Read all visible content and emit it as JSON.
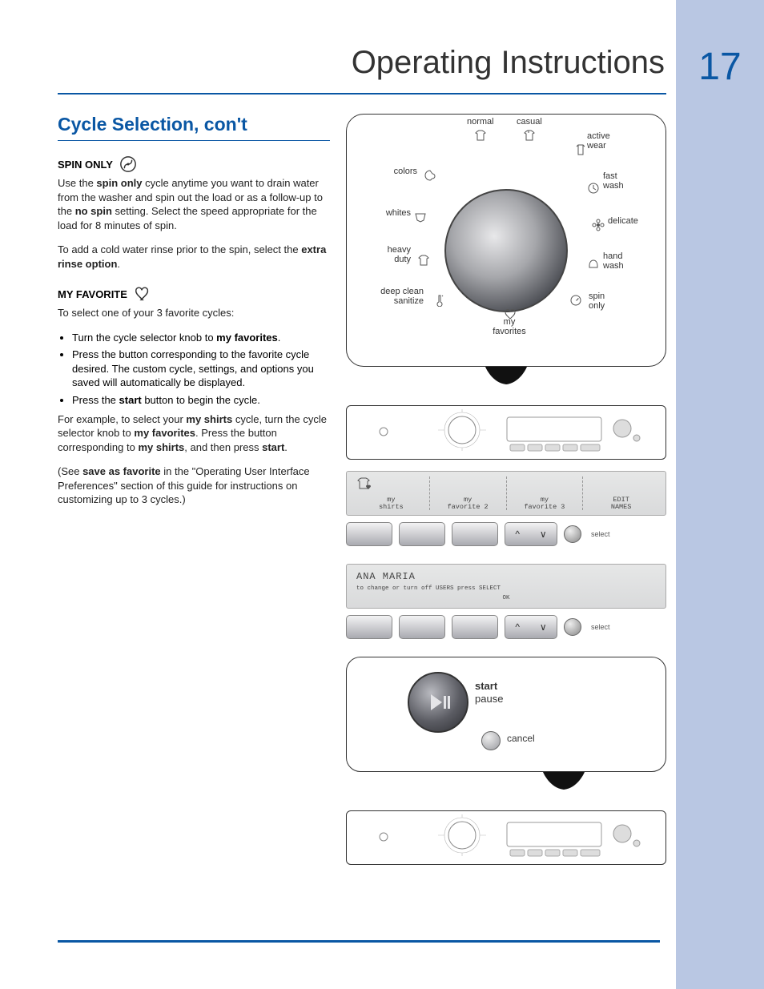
{
  "header": {
    "title": "Operating Instructions",
    "page_number": "17"
  },
  "section": {
    "title": "Cycle Selection, con't"
  },
  "spin_only": {
    "heading": "SPIN ONLY",
    "p1a": "Use the ",
    "p1b": "spin only",
    "p1c": " cycle anytime you want to drain water from the washer and spin out the load or as a follow-up to the ",
    "p1d": "no spin",
    "p1e": " setting. Select the speed appropriate for the load for 8 minutes of spin.",
    "p2a": "To add a cold water rinse prior to the spin, select the ",
    "p2b": "extra rinse option",
    "p2c": "."
  },
  "my_favorite": {
    "heading": "MY FAVORITE",
    "intro": "To select one of your 3 favorite cycles:",
    "b1a": "Turn the cycle selector knob to ",
    "b1b": "my favorites",
    "b1c": ".",
    "b2": "Press the button corresponding to the favorite cycle desired. The custom cycle, settings, and options you saved will automatically be displayed.",
    "b3a": "Press the ",
    "b3b": "start",
    "b3c": " button to begin the cycle.",
    "ex1": "For example, to select your ",
    "ex2": "my shirts",
    "ex3": " cycle, turn the cycle selector knob to ",
    "ex4": "my favorites",
    "ex5": ". Press the button corresponding to ",
    "ex6": "my shirts",
    "ex7": ", and then press ",
    "ex8": "start",
    "ex9": ".",
    "note1": "(See ",
    "note2": "save as favorite",
    "note3": " in the \"Operating User Interface Preferences\" section of this guide for instructions on customizing up to 3 cycles.)"
  },
  "dial": {
    "labels": {
      "normal": "normal",
      "casual": "casual",
      "active_wear": "active\nwear",
      "fast_wash": "fast\nwash",
      "delicate": "delicate",
      "hand_wash": "hand\nwash",
      "spin_only": "spin\nonly",
      "my_favorites": "my\nfavorites",
      "deep_clean_sanitize": "deep clean\nsanitize",
      "heavy_duty": "heavy\nduty",
      "whites": "whites",
      "colors": "colors"
    }
  },
  "lcd_favorites": {
    "seg1_line1": "my",
    "seg1_line2": "shirts",
    "seg2_line1": "my",
    "seg2_line2": "favorite 2",
    "seg3_line1": "my",
    "seg3_line2": "favorite 3",
    "seg4_line1": "EDIT",
    "seg4_line2": "NAMES"
  },
  "buttons": {
    "select": "select"
  },
  "lcd_user": {
    "line1": "ANA MARIA",
    "line2": "to change or turn off USERS press SELECT",
    "line3": "OK"
  },
  "start_panel": {
    "start": "start",
    "pause": "pause",
    "cancel": "cancel"
  }
}
